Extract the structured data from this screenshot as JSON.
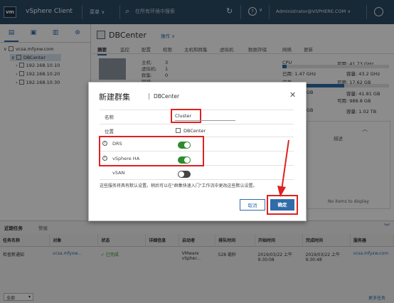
{
  "topbar": {
    "logo": "vm",
    "app_name": "vSphere Client",
    "menu_label": "菜单 ∨",
    "search_placeholder": "在所有环境中搜索",
    "help_label": "?",
    "user_label": "Administrator@VSPHERE.COM ∨"
  },
  "nav": {
    "tree": [
      {
        "label": "vcsa.mfyxw.com",
        "level": 0
      },
      {
        "label": "DBCenter",
        "level": 1
      },
      {
        "label": "192.168.10.10",
        "level": 2
      },
      {
        "label": "192.168.10.20",
        "level": 2
      },
      {
        "label": "192.168.10.30",
        "level": 2
      }
    ]
  },
  "content": {
    "title": "DBCenter",
    "actions": "操作 ∨",
    "tabs": [
      "摘要",
      "监控",
      "配置",
      "权限",
      "主机和群集",
      "虚拟机",
      "数据存储",
      "网络",
      "更新"
    ],
    "summary_labels": [
      "主机:",
      "虚拟机:",
      "群集:",
      "网络:"
    ],
    "summary_values": [
      "3",
      "1",
      "0",
      ""
    ],
    "resource": {
      "cpu_label": "CPU",
      "cpu_free": "可用: 41.73 GHz",
      "used1": "已用: 1.47 GHz",
      "cap1": "容量: 43.2 GHz",
      "mem_label": "内存",
      "mem_free": "可用: 17.62 GB",
      "used2": "GB",
      "cap2": "容量: 41.81 GB",
      "storage_free": "可用: 988.8 GB",
      "used3": "GB",
      "cap3": "容量: 1.02 TB"
    },
    "no_items": "No items to display"
  },
  "bottom": {
    "tab_recent": "近期任务",
    "tab_alarms": "警报",
    "columns": [
      "任务名称",
      "对象",
      "状态",
      "详细信息",
      "启动者",
      "排队时间",
      "开始时间",
      "完成时间",
      "服务器"
    ],
    "rows": [
      [
        "检查新通知",
        "vcsa.mfyxw...",
        "✓ 已完成",
        "",
        "VMware vSpher...",
        "528 毫秒",
        "2019/03/22 上午 9:30:08",
        "2019/03/22 上午 9:30:48",
        "vcsa.mfyxw.com"
      ]
    ],
    "filter_value": "全部",
    "more_tasks": "更多任务"
  },
  "dialog": {
    "title": "新建群集",
    "subtitle": "DBCenter",
    "name_label": "名称",
    "name_value": "Cluster",
    "location_label": "位置",
    "location_value": "DBCenter",
    "drs_label": "DRS",
    "ha_label": "vSphere HA",
    "vsan_label": "vSAN",
    "drs_on": true,
    "ha_on": true,
    "vsan_on": false,
    "note": "这些服务将具有默认设置。稍后可以在\"群集快速入门\"工作流中更改这些默认设置。",
    "cancel_label": "取消",
    "ok_label": "确定"
  },
  "colors": {
    "topbar": "#2b4a64",
    "accent": "#2f6ca8",
    "toggle_on": "#2e8b2e",
    "annotation": "#e02020"
  }
}
